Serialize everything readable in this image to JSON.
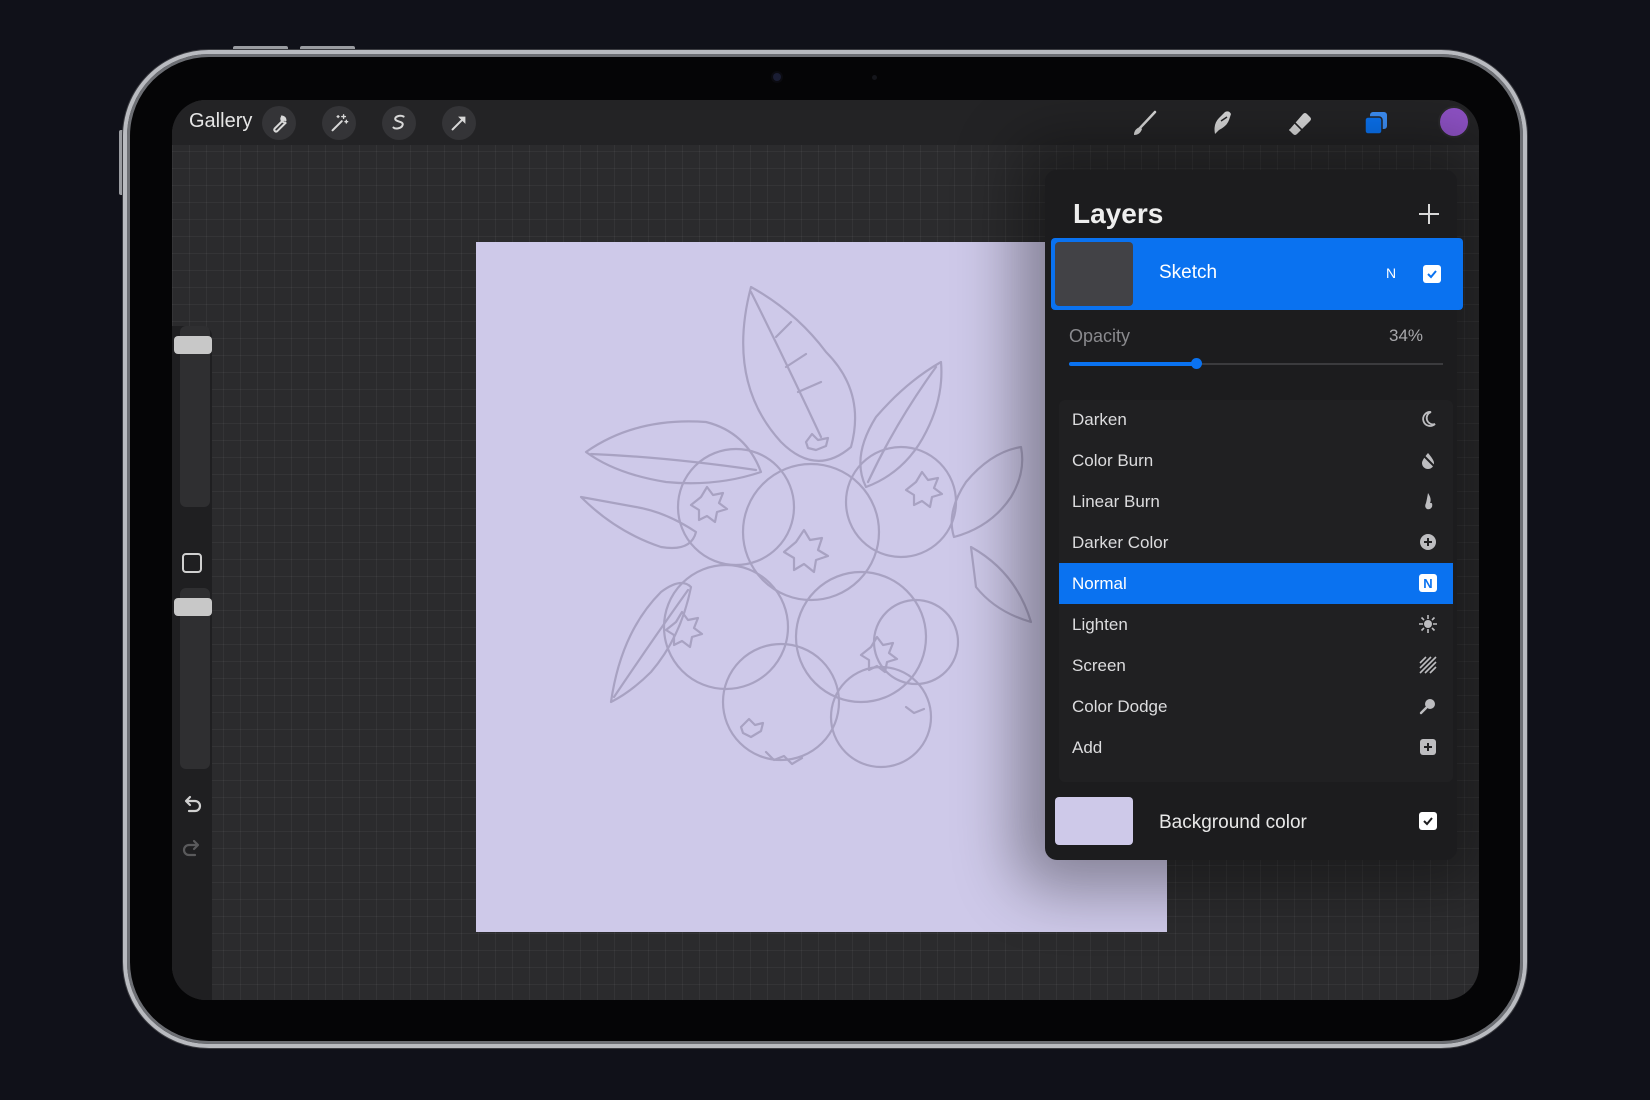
{
  "toolbar": {
    "gallery_label": "Gallery",
    "left_icons": [
      "wrench-icon",
      "magic-wand-icon",
      "selection-icon",
      "transform-arrow-icon"
    ],
    "right_icons": [
      "brush-icon",
      "smudge-icon",
      "eraser-icon",
      "layers-icon"
    ],
    "current_color": "#8f52c6"
  },
  "sidebar": {
    "icons": [
      "modify-square-icon",
      "undo-icon",
      "redo-icon"
    ]
  },
  "canvas": {
    "background": "#cec9e9",
    "stroke_color": "#a8a2c2"
  },
  "layers_panel": {
    "title": "Layers",
    "add_icon": "plus-icon",
    "active_layer": {
      "name": "Sketch",
      "blend_mode_abbrev": "N",
      "visible": true,
      "highlight_color": "#0a72f0"
    },
    "opacity": {
      "label": "Opacity",
      "value_text": "34%",
      "value": 0.34
    },
    "blend_modes": [
      {
        "label": "Darken",
        "icon": "moon-icon",
        "selected": false
      },
      {
        "label": "Color Burn",
        "icon": "burn-drop-icon",
        "selected": false
      },
      {
        "label": "Linear Burn",
        "icon": "flame-icon",
        "selected": false
      },
      {
        "label": "Darker Color",
        "icon": "plus-circle-icon",
        "selected": false
      },
      {
        "label": "Normal",
        "icon": "n-badge-icon",
        "selected": true,
        "badge": "N"
      },
      {
        "label": "Lighten",
        "icon": "sun-icon",
        "selected": false
      },
      {
        "label": "Screen",
        "icon": "hatch-icon",
        "selected": false
      },
      {
        "label": "Color Dodge",
        "icon": "dodge-icon",
        "selected": false
      },
      {
        "label": "Add",
        "icon": "plus-square-icon",
        "selected": false
      }
    ],
    "background_layer": {
      "name": "Background color",
      "color": "#cec9e9",
      "visible": true
    }
  }
}
